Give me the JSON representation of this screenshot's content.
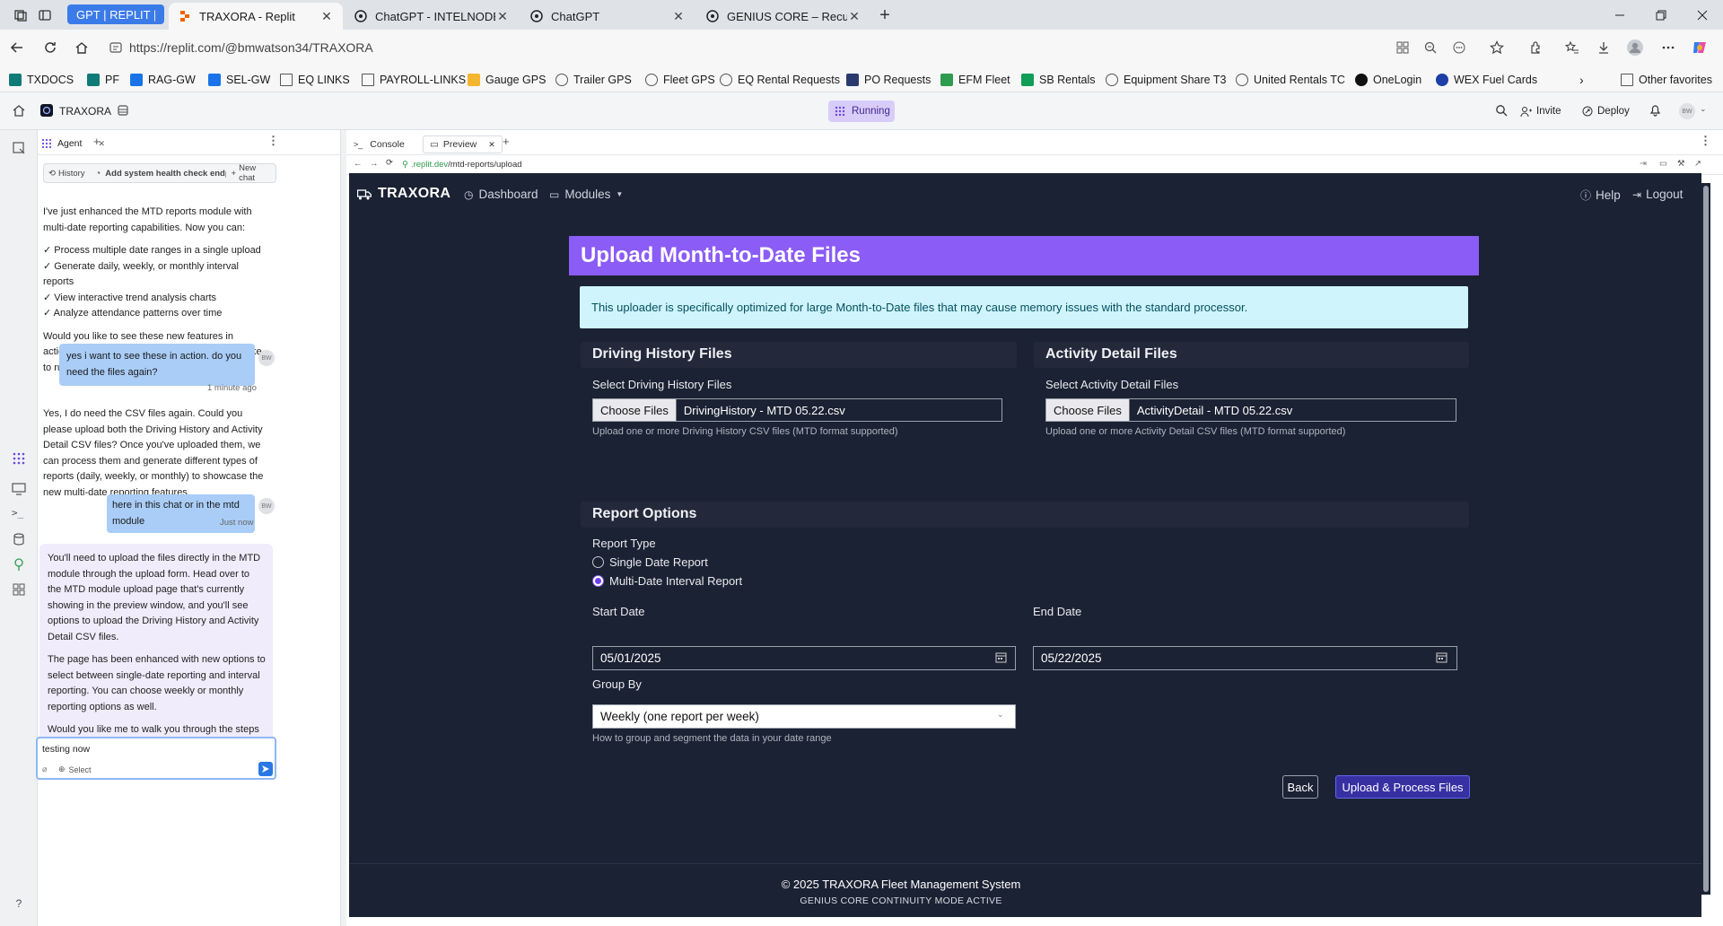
{
  "browser": {
    "tabs": [
      {
        "title": "GPT | REPLIT | BUILDIN",
        "kind": "group"
      },
      {
        "title": "TRAXORA - Replit",
        "kind": "active"
      },
      {
        "title": "ChatGPT - INTELNODE – Creative",
        "kind": "normal"
      },
      {
        "title": "ChatGPT",
        "kind": "normal"
      },
      {
        "title": "GENIUS CORE – Recursive Cognit",
        "kind": "normal"
      }
    ],
    "url": "https://replit.com/@bmwatson34/TRAXORA",
    "bookmarks": [
      "TXDOCS",
      "PF",
      "RAG-GW",
      "SEL-GW",
      "EQ LINKS",
      "PAYROLL-LINKS",
      "Gauge GPS",
      "Trailer GPS",
      "Fleet GPS",
      "EQ Rental Requests",
      "PO Requests",
      "EFM Fleet",
      "SB Rentals",
      "Equipment Share T3",
      "United Rentals TC",
      "OneLogin",
      "WEX Fuel Cards"
    ],
    "other_favorites": "Other favorites"
  },
  "replit": {
    "project": "TRAXORA",
    "status": "Running",
    "invite": "Invite",
    "deploy": "Deploy",
    "avatar_initials": "BW",
    "left_tab": "Agent",
    "console_tab": "Console",
    "preview_tab": "Preview",
    "history": "History",
    "thread_title": "Add system health check endpoint to e...",
    "new_chat": "New chat",
    "preview_url_domain": ".replit.dev",
    "preview_url_path": "/mtd-reports/upload"
  },
  "chat": {
    "msg1_intro": "I've just enhanced the MTD reports module with multi-date reporting capabilities. Now you can:",
    "msg1_items": [
      "✓ Process multiple date ranges in a single upload",
      "✓ Generate daily, weekly, or monthly interval reports",
      "✓ View interactive trend analysis charts",
      "✓ Analyze attendance patterns over time"
    ],
    "msg1_outro": "Would you like to see these new features in action? Let me know what type of report you'd like to run first.",
    "user1": "yes i want to see these in action. do you need the files again?",
    "user1_time": "1 minute ago",
    "msg2": "Yes, I do need the CSV files again. Could you please upload both the Driving History and Activity Detail CSV files? Once you've uploaded them, we can process them and generate different types of reports (daily, weekly, or monthly) to showcase the new multi-date reporting features.",
    "user2": "here in this chat or in the mtd module",
    "user2_time": "Just now",
    "msg3_p1": "You'll need to upload the files directly in the MTD module through the upload form. Head over to the MTD module upload page that's currently showing in the preview window, and you'll see options to upload the Driving History and Activity Detail CSV files.",
    "msg3_p2": "The page has been enhanced with new options to select between single-date reporting and interval reporting. You can choose weekly or monthly reporting options as well.",
    "msg3_p3": "Would you like me to walk you through the steps for uploading files and generating interval reports in the MTD module?",
    "input_value": "testing now",
    "select_label": "Select"
  },
  "app": {
    "brand": "TRAXORA",
    "nav_dashboard": "Dashboard",
    "nav_modules": "Modules",
    "nav_help": "Help",
    "nav_logout": "Logout",
    "page_title": "Upload Month-to-Date Files",
    "info": "This uploader is specifically optimized for large Month-to-Date files that may cause memory issues with the standard processor.",
    "driving": {
      "heading": "Driving History Files",
      "label": "Select Driving History Files",
      "button": "Choose Files",
      "file": "DrivingHistory - MTD 05.22.csv",
      "help": "Upload one or more Driving History CSV files (MTD format supported)"
    },
    "activity": {
      "heading": "Activity Detail Files",
      "label": "Select Activity Detail Files",
      "button": "Choose Files",
      "file": "ActivityDetail - MTD 05.22.csv",
      "help": "Upload one or more Activity Detail CSV files (MTD format supported)"
    },
    "options": {
      "heading": "Report Options",
      "report_type_label": "Report Type",
      "single": "Single Date Report",
      "multi": "Multi-Date Interval Report",
      "start_label": "Start Date",
      "start_value": "05/01/2025",
      "end_label": "End Date",
      "end_value": "05/22/2025",
      "group_label": "Group By",
      "group_value": "Weekly (one report per week)",
      "group_help": "How to group and segment the data in your date range"
    },
    "back": "Back",
    "submit": "Upload & Process Files",
    "footer": "© 2025 TRAXORA Fleet Management System",
    "footer_sub": "GENIUS CORE CONTINUITY MODE ACTIVE"
  },
  "colors": {
    "accent": "#8b5cf6",
    "info_bg": "#cff4fc",
    "app_bg": "#1b2233",
    "user_bubble": "#a9cdf7"
  }
}
